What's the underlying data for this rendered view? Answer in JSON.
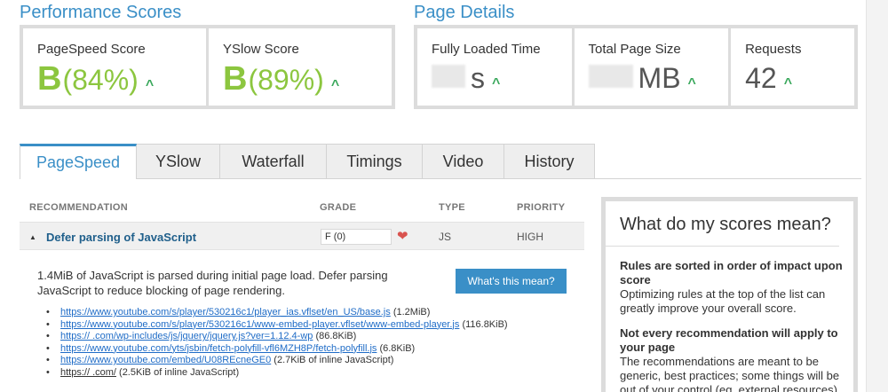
{
  "performance": {
    "title": "Performance Scores",
    "pagespeed": {
      "label": "PageSpeed Score",
      "grade": "B",
      "percent": "(84%)"
    },
    "yslow": {
      "label": "YSlow Score",
      "grade": "B",
      "percent": "(89%)"
    }
  },
  "details": {
    "title": "Page Details",
    "loaded": {
      "label": "Fully Loaded Time",
      "unit": "s"
    },
    "size": {
      "label": "Total Page Size",
      "unit": "MB"
    },
    "requests": {
      "label": "Requests",
      "value": "42"
    }
  },
  "tabs": [
    {
      "label": "PageSpeed"
    },
    {
      "label": "YSlow"
    },
    {
      "label": "Waterfall"
    },
    {
      "label": "Timings"
    },
    {
      "label": "Video"
    },
    {
      "label": "History"
    }
  ],
  "table": {
    "headers": {
      "recommendation": "RECOMMENDATION",
      "grade": "GRADE",
      "type": "TYPE",
      "priority": "PRIORITY"
    },
    "row": {
      "title": "Defer parsing of JavaScript",
      "grade": "F (0)",
      "type": "JS",
      "priority": "HIGH"
    }
  },
  "recommendation": {
    "description": "1.4MiB of JavaScript is parsed during initial page load. Defer parsing JavaScript to reduce blocking of page rendering.",
    "button": "What's this mean?",
    "resources": [
      {
        "url": "https://www.youtube.com/s/player/530216c1/player_ias.vflset/en_US/base.js",
        "size": "(1.2MiB)"
      },
      {
        "url": "https://www.youtube.com/s/player/530216c1/www-embed-player.vflset/www-embed-player.js",
        "size": "(116.8KiB)"
      },
      {
        "url": "https://             .com/wp-includes/js/jquery/jquery.js?ver=1.12.4-wp",
        "size": "(86.8KiB)"
      },
      {
        "url": "https://www.youtube.com/yts/jsbin/fetch-polyfill-vfl6MZH8P/fetch-polyfill.js",
        "size": "(6.8KiB)"
      },
      {
        "url": "https://www.youtube.com/embed/U08REcneGE0",
        "size": "(2.7KiB of inline JavaScript)"
      },
      {
        "url": "https://             .com/",
        "size": "(2.5KiB of inline JavaScript)"
      }
    ]
  },
  "sidebar": {
    "title": "What do my scores mean?",
    "h1": "Rules are sorted in order of impact upon score",
    "p1": "Optimizing rules at the top of the list can greatly improve your overall score.",
    "h2": "Not every recommendation will apply to your page",
    "p2": "The recommendations are meant to be generic, best practices; some things will be out of your control (eg. external resources) or may not apply to your page"
  },
  "colors": {
    "accent": "#3a8fc7",
    "grade_good": "#8cc63f",
    "arrow": "#3aa85c",
    "grade_bad": "#d9534f"
  }
}
